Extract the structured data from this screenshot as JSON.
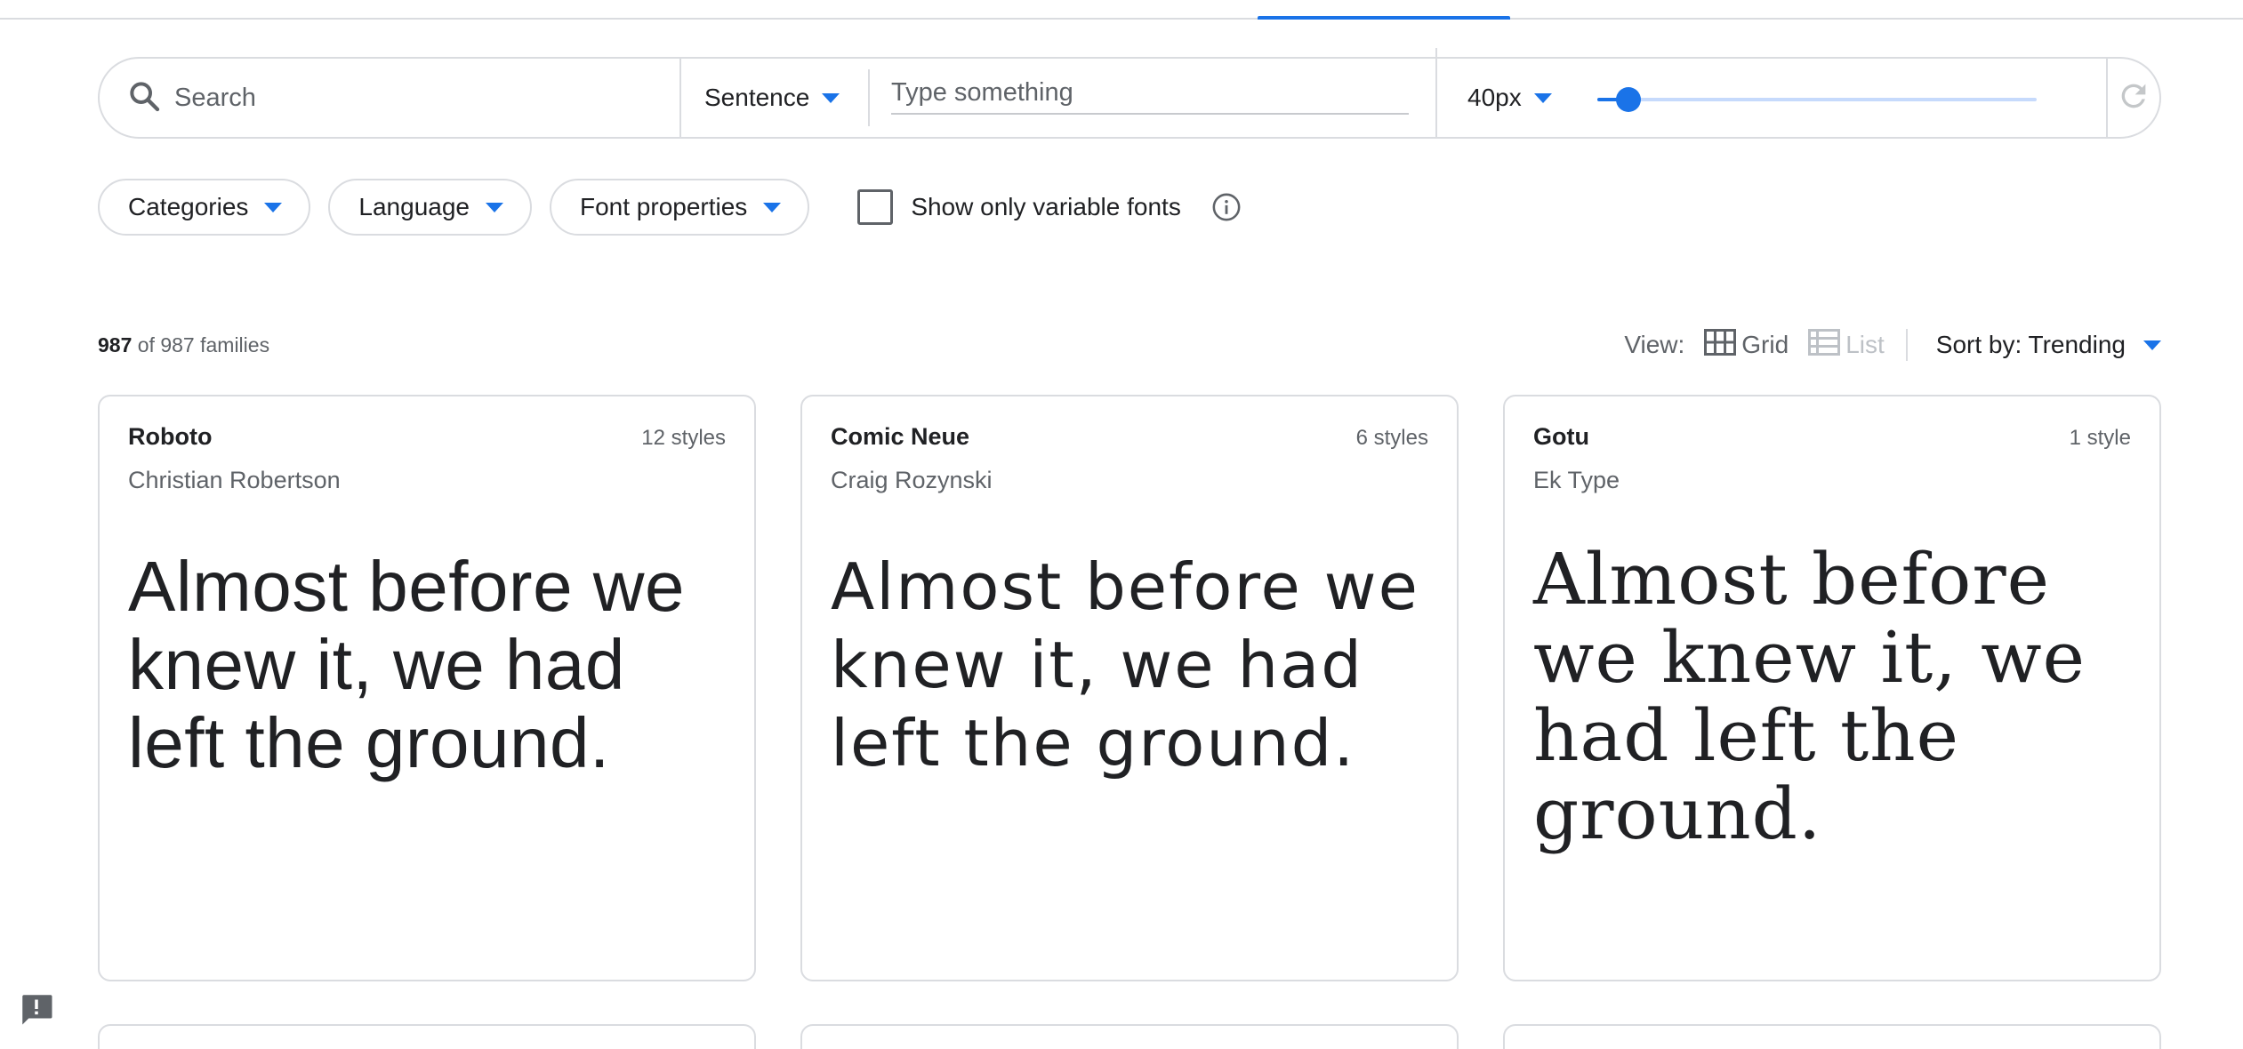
{
  "toolbar": {
    "search_placeholder": "Search",
    "preview_mode": "Sentence",
    "preview_text_placeholder": "Type something",
    "font_size": "40px",
    "font_size_slider_fraction": 0.07,
    "reset_icon": "refresh-icon"
  },
  "filters": {
    "categories": "Categories",
    "language": "Language",
    "font_properties": "Font properties",
    "variable_only_label": "Show only variable fonts",
    "variable_only_checked": false
  },
  "results": {
    "shown": "987",
    "total_text": "of 987 families"
  },
  "view": {
    "label": "View:",
    "grid": "Grid",
    "list": "List",
    "sort": "Sort by: Trending"
  },
  "cards": [
    {
      "name": "Roboto",
      "styles": "12 styles",
      "designer": "Christian Robertson",
      "sample": "Almost before we knew it, we had left the ground."
    },
    {
      "name": "Comic Neue",
      "styles": "6 styles",
      "designer": "Craig Rozynski",
      "sample": "Almost before we knew it, we had left the ground."
    },
    {
      "name": "Gotu",
      "styles": "1 style",
      "designer": "Ek Type",
      "sample": "Almost before we knew it, we had left the ground."
    }
  ],
  "colors": {
    "accent": "#1a73e8",
    "border": "#dadce0",
    "text": "#202124",
    "secondary_text": "#5f6368"
  }
}
